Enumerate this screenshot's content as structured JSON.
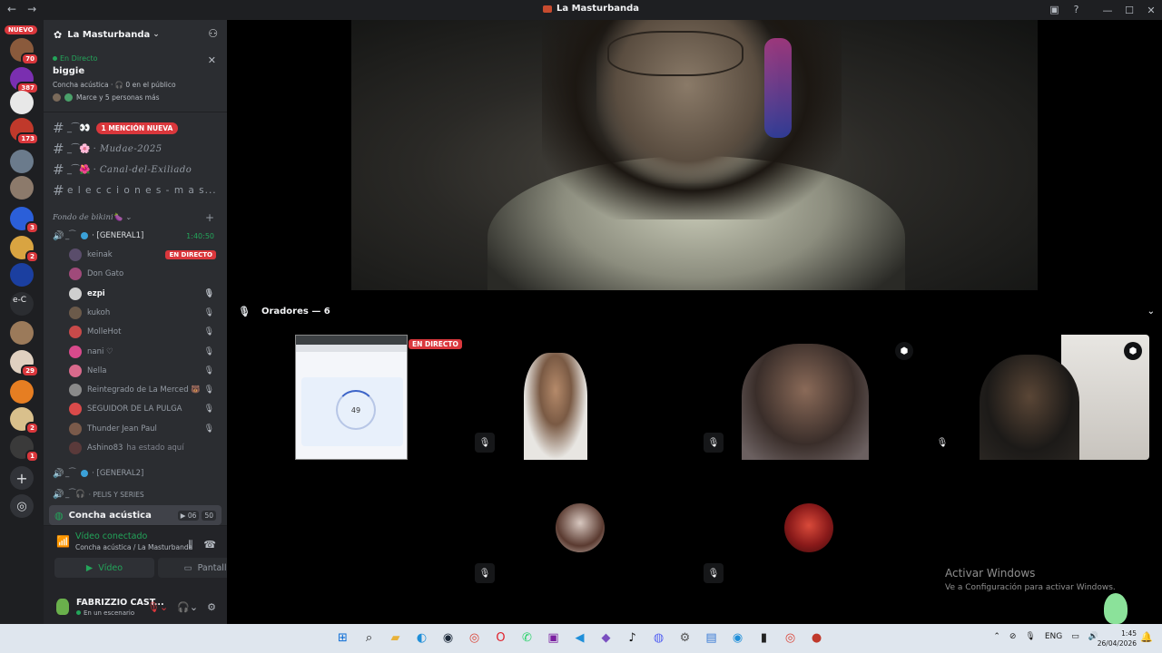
{
  "window": {
    "title": "La Masturbanda",
    "back_glyph": "←",
    "forward_glyph": "→",
    "controls": [
      "—",
      "☐",
      "✕"
    ]
  },
  "server_rail": {
    "new_label": "NUEVO",
    "servers": [
      {
        "name": "server-1",
        "badge": "70",
        "color": "#8a5a3c"
      },
      {
        "name": "server-2",
        "badge": "387",
        "color": "#7a2fb0"
      },
      {
        "name": "server-3",
        "badge": "",
        "color": "#e8e8e8"
      },
      {
        "name": "server-4",
        "badge": "173",
        "color": "#c0392b"
      },
      {
        "name": "server-5",
        "badge": "",
        "color": "#6b7b8c"
      },
      {
        "name": "server-6",
        "badge": "",
        "color": "#8c7a6b"
      },
      {
        "name": "server-7",
        "badge": "3",
        "color": "#2b5fd9"
      },
      {
        "name": "server-8",
        "badge": "2",
        "color": "#d9a441"
      },
      {
        "name": "server-9",
        "badge": "",
        "color": "#1b3fa0"
      },
      {
        "name": "server-10",
        "badge": "",
        "color": "#2b2d31"
      },
      {
        "name": "server-11",
        "badge": "",
        "color": "#9b7a5a"
      },
      {
        "name": "server-12",
        "badge": "29",
        "color": "#e0d0c0"
      },
      {
        "name": "server-13",
        "badge": "",
        "color": "#e67e22"
      },
      {
        "name": "server-14",
        "badge": "2",
        "color": "#d9c08c"
      },
      {
        "name": "server-15",
        "badge": "1",
        "color": "#3a3a3a"
      }
    ],
    "rail_text": "e-C",
    "add_glyph": "+",
    "discover_glyph": "◎"
  },
  "server": {
    "name": "La Masturbanda",
    "caret": "⌄"
  },
  "live_card": {
    "status": "En Directo",
    "title": "biggie",
    "meta": "Concha acústica · 🎧 0 en el público",
    "people": "Marce y 5 personas más",
    "close": "✕"
  },
  "channels": [
    {
      "name": "",
      "prefix": "_⁀👀",
      "mention": "1 MENCIÓN NUEVA"
    },
    {
      "name": "Mudae-2025",
      "prefix": "_⁀🌸 ·",
      "mention": ""
    },
    {
      "name": "Canal-del-Exiliado",
      "prefix": "_⁀🌺 ·",
      "mention": ""
    },
    {
      "name": "e l e c c i o n e s - m a s...",
      "prefix": "",
      "mention": ""
    }
  ],
  "category": {
    "name": "Fondo de bikini🍆 ⌄",
    "plus": "+"
  },
  "voice_general1": {
    "name": "· [GENERAL1]",
    "prefix": "_⁀",
    "timer": "1:40:50"
  },
  "members": [
    {
      "name": "keinak",
      "badge": "EN DIRECTO",
      "muted": false,
      "bold": false,
      "color": "#5a4d6b",
      "after": ""
    },
    {
      "name": "Don Gato",
      "badge": "",
      "muted": false,
      "bold": false,
      "color": "#a04a7a",
      "after": ""
    },
    {
      "name": "ezpi",
      "badge": "",
      "muted": true,
      "bold": true,
      "color": "#cfcfcf",
      "after": ""
    },
    {
      "name": "kukoh",
      "badge": "",
      "muted": true,
      "bold": false,
      "color": "#6b5a4a",
      "after": ""
    },
    {
      "name": "MolleHot",
      "badge": "",
      "muted": true,
      "bold": false,
      "color": "#c84a4a",
      "after": ""
    },
    {
      "name": "nani ♡",
      "badge": "",
      "muted": true,
      "bold": false,
      "color": "#d94a8c",
      "after": ""
    },
    {
      "name": "Nella",
      "badge": "",
      "muted": true,
      "bold": false,
      "color": "#d96a8c",
      "after": ""
    },
    {
      "name": "Reintegrado de La Merced 🐻",
      "badge": "",
      "muted": true,
      "bold": false,
      "color": "#8a8a8a",
      "after": ""
    },
    {
      "name": "SEGUIDOR DE LA PULGA",
      "badge": "",
      "muted": true,
      "bold": false,
      "color": "#d94a4a",
      "after": ""
    },
    {
      "name": "Thunder Jean Paul",
      "badge": "",
      "muted": true,
      "bold": false,
      "color": "#7a5a4a",
      "after": ""
    },
    {
      "name": "Ashino83",
      "badge": "",
      "muted": false,
      "bold": false,
      "color": "#5a3a3a",
      "after": "ha estado aquí"
    }
  ],
  "voice_general2": {
    "name": "· [GENERAL2]",
    "prefix": "_⁀"
  },
  "voice_pelis": {
    "name": "· PELIS Y SERIES",
    "prefix": "_⁀🎧"
  },
  "stage_channel": {
    "name": "Concha acústica",
    "cam_count": "06",
    "user_count": "50"
  },
  "voice_panel": {
    "status": "Vídeo conectado",
    "location": "Concha acústica / La Masturbanda",
    "video_label": "Vídeo",
    "screen_label": "Pantalla"
  },
  "user": {
    "name": "FABRIZZIO CAST...",
    "status": "En un escenario"
  },
  "stage": {
    "speakers_label": "Oradores — 6",
    "live_badge": "EN DIRECTO",
    "share_value": "49"
  },
  "tiles": [
    {
      "name": "tile-1",
      "muted": true,
      "moderator": false,
      "bg": "#f3f3f3"
    },
    {
      "name": "tile-2",
      "muted": true,
      "moderator": true,
      "bg": "#6b6060"
    },
    {
      "name": "tile-3",
      "muted": true,
      "moderator": true,
      "bg": "#4a4640"
    },
    {
      "name": "tile-4",
      "muted": true,
      "moderator": false,
      "bg": "#8a7d77"
    },
    {
      "name": "tile-5",
      "muted": true,
      "moderator": false,
      "bg": "#ef9b7c"
    }
  ],
  "watermark": {
    "line1": "Activar Windows",
    "line2": "Ve a Configuración para activar Windows."
  },
  "taskbar": {
    "apps": [
      {
        "name": "start",
        "glyph": "⊞",
        "color": "#0a6cd6"
      },
      {
        "name": "search",
        "glyph": "⌕",
        "color": "#1a1a1a"
      },
      {
        "name": "files",
        "glyph": "▰",
        "color": "#e8b23a"
      },
      {
        "name": "edge",
        "glyph": "◐",
        "color": "#1f8fd9"
      },
      {
        "name": "steam",
        "glyph": "◉",
        "color": "#1b2838"
      },
      {
        "name": "chrome",
        "glyph": "◎",
        "color": "#db4437"
      },
      {
        "name": "opera",
        "glyph": "O",
        "color": "#e0202a"
      },
      {
        "name": "whatsapp",
        "glyph": "✆",
        "color": "#25d366"
      },
      {
        "name": "ide",
        "glyph": "▣",
        "color": "#7a1fa0"
      },
      {
        "name": "vscode",
        "glyph": "◀",
        "color": "#1f8fd9"
      },
      {
        "name": "visual-studio",
        "glyph": "◆",
        "color": "#7a4fc0"
      },
      {
        "name": "tiktok",
        "glyph": "♪",
        "color": "#111111"
      },
      {
        "name": "discord",
        "glyph": "◍",
        "color": "#5865f2"
      },
      {
        "name": "settings",
        "glyph": "⚙",
        "color": "#555555"
      },
      {
        "name": "notepad",
        "glyph": "▤",
        "color": "#3a7bd5"
      },
      {
        "name": "messenger",
        "glyph": "◉",
        "color": "#1f8fd9"
      },
      {
        "name": "terminal",
        "glyph": "▮",
        "color": "#222222"
      },
      {
        "name": "chrome-2",
        "glyph": "◎",
        "color": "#db4437"
      },
      {
        "name": "app-red",
        "glyph": "●",
        "color": "#c0392b"
      }
    ],
    "lang": "ENG",
    "time": "1:45",
    "date": "26/04/2026"
  }
}
